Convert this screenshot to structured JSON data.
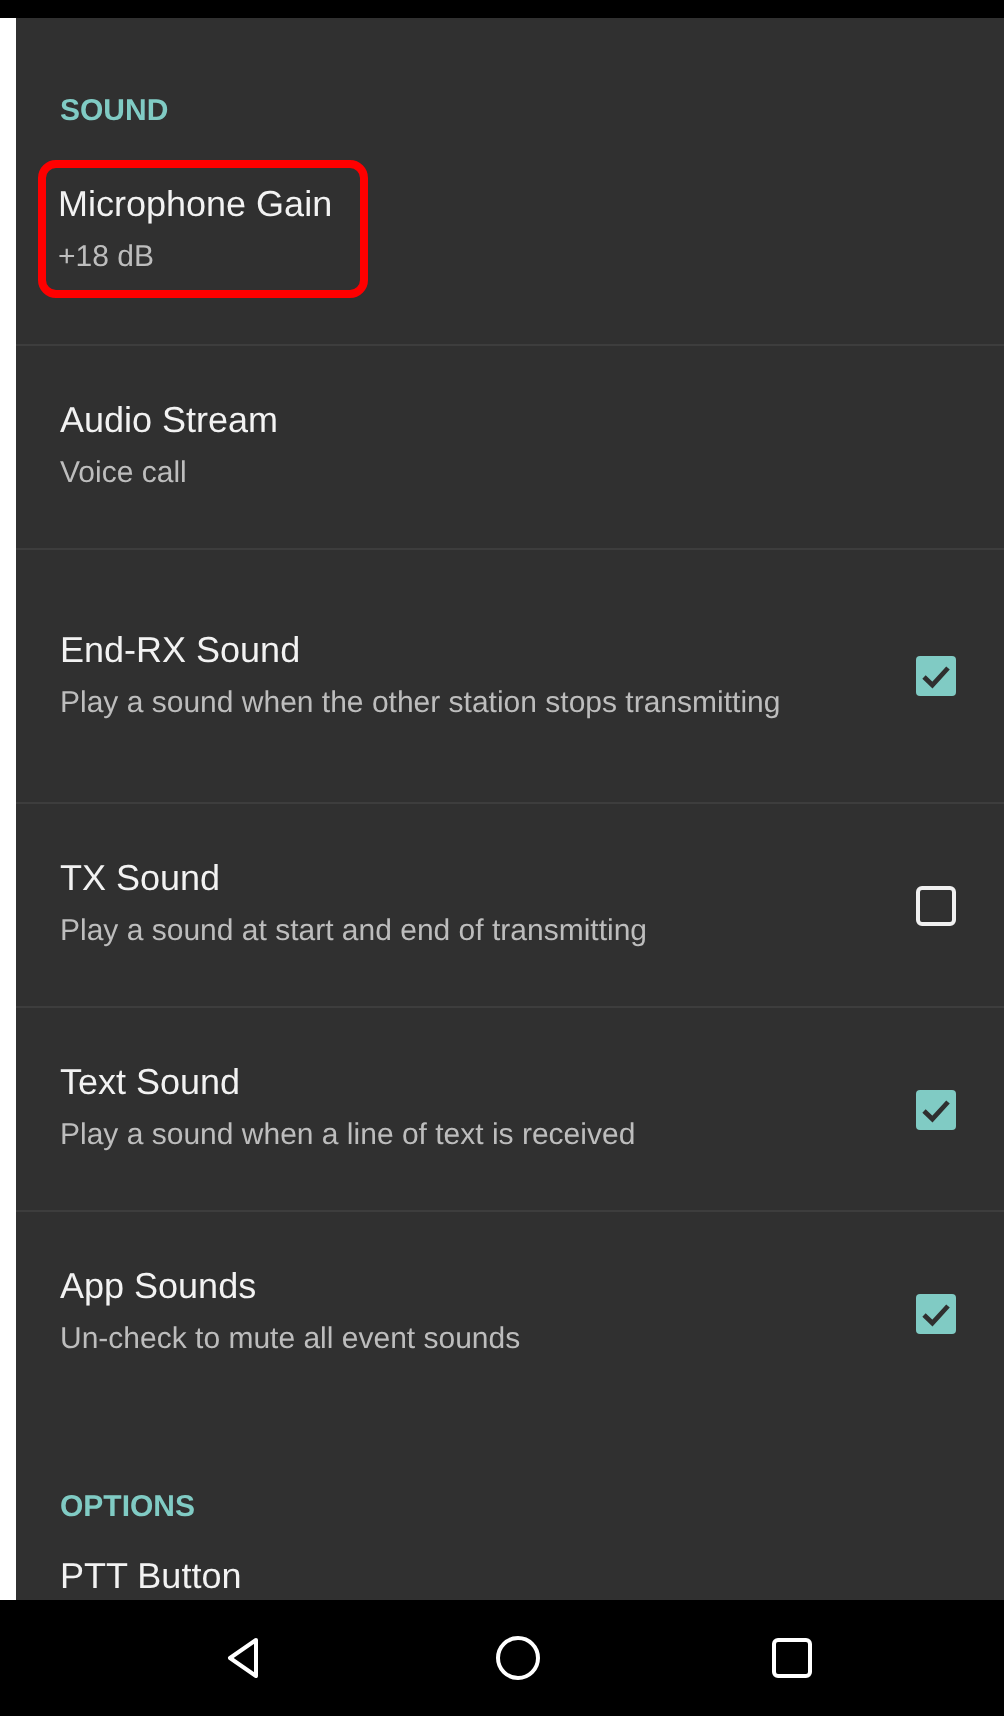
{
  "sections": [
    {
      "header": "SOUND",
      "items": [
        {
          "kind": "plain",
          "title": "Microphone Gain",
          "summary": "+18 dB",
          "highlighted": true
        },
        {
          "kind": "plain",
          "title": "Audio Stream",
          "summary": "Voice call",
          "highlighted": false
        },
        {
          "kind": "checkbox",
          "title": "End-RX Sound",
          "summary": "Play a sound when the other station stops transmitting",
          "checked": true,
          "highlighted": false
        },
        {
          "kind": "checkbox",
          "title": "TX Sound",
          "summary": "Play a sound at start and end of transmitting",
          "checked": false,
          "highlighted": false
        },
        {
          "kind": "checkbox",
          "title": "Text Sound",
          "summary": "Play a sound when a line of text is received",
          "checked": true,
          "highlighted": false
        },
        {
          "kind": "checkbox",
          "title": "App Sounds",
          "summary": "Un-check to mute all event sounds",
          "checked": true,
          "highlighted": false
        }
      ]
    },
    {
      "header": "OPTIONS",
      "items": [
        {
          "kind": "plain",
          "title": "PTT Button",
          "highlighted": false
        }
      ]
    }
  ]
}
